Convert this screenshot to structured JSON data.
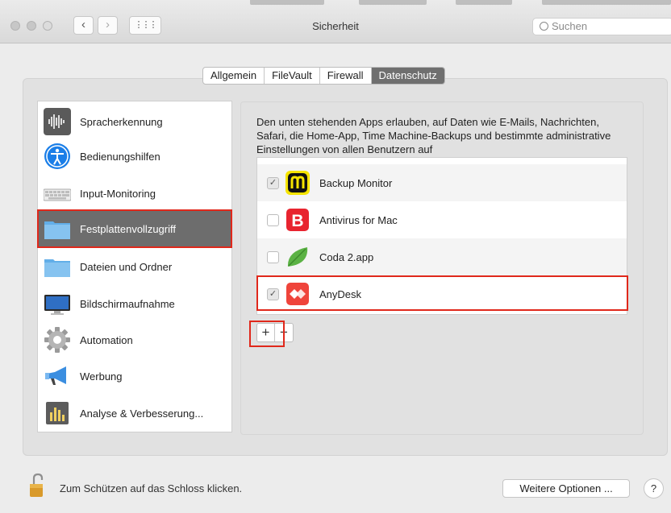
{
  "window": {
    "title": "Sicherheit"
  },
  "nav": {
    "back": "‹",
    "forward": "›",
    "grid": "⋮⋮⋮"
  },
  "search": {
    "placeholder": "Suchen",
    "icon": "search-icon"
  },
  "tabs": [
    {
      "label": "Allgemein",
      "active": false
    },
    {
      "label": "FileVault",
      "active": false
    },
    {
      "label": "Firewall",
      "active": false
    },
    {
      "label": "Datenschutz",
      "active": true
    }
  ],
  "sidebar": {
    "items": [
      {
        "label": "Spracherkennung",
        "icon": "waveform-icon"
      },
      {
        "label": "Bedienungshilfen",
        "icon": "accessibility-icon"
      },
      {
        "label": "Input-Monitoring",
        "icon": "keyboard-icon"
      },
      {
        "label": "Festplattenvollzugriff",
        "icon": "folder-icon",
        "selected": true
      },
      {
        "label": "Dateien und Ordner",
        "icon": "folder-icon"
      },
      {
        "label": "Bildschirmaufnahme",
        "icon": "display-icon"
      },
      {
        "label": "Automation",
        "icon": "gear-icon"
      },
      {
        "label": "Werbung",
        "icon": "megaphone-icon"
      },
      {
        "label": "Analyse & Verbesserung...",
        "icon": "chart-icon"
      }
    ]
  },
  "description": "Den unten stehenden Apps erlauben, auf Daten wie E-Mails, Nachrichten, Safari, die Home-App, Time Machine-Backups und bestimmte administrative Einstellungen von allen Benutzern auf",
  "apps": [
    {
      "label": "Backup Monitor",
      "checked": true,
      "icon": "backup-monitor-icon"
    },
    {
      "label": "Antivirus for Mac",
      "checked": false,
      "icon": "bitdefender-icon"
    },
    {
      "label": "Coda 2.app",
      "checked": false,
      "icon": "coda-leaf-icon"
    },
    {
      "label": "AnyDesk",
      "checked": true,
      "icon": "anydesk-icon"
    }
  ],
  "buttons": {
    "add": "+",
    "remove": "−",
    "more_options": "Weitere Optionen ...",
    "help": "?"
  },
  "footer": {
    "lock_text": "Zum Schützen auf das Schloss klicken."
  },
  "colors": {
    "highlight": "#e0281b",
    "selected_bg": "#6d6d6d"
  }
}
